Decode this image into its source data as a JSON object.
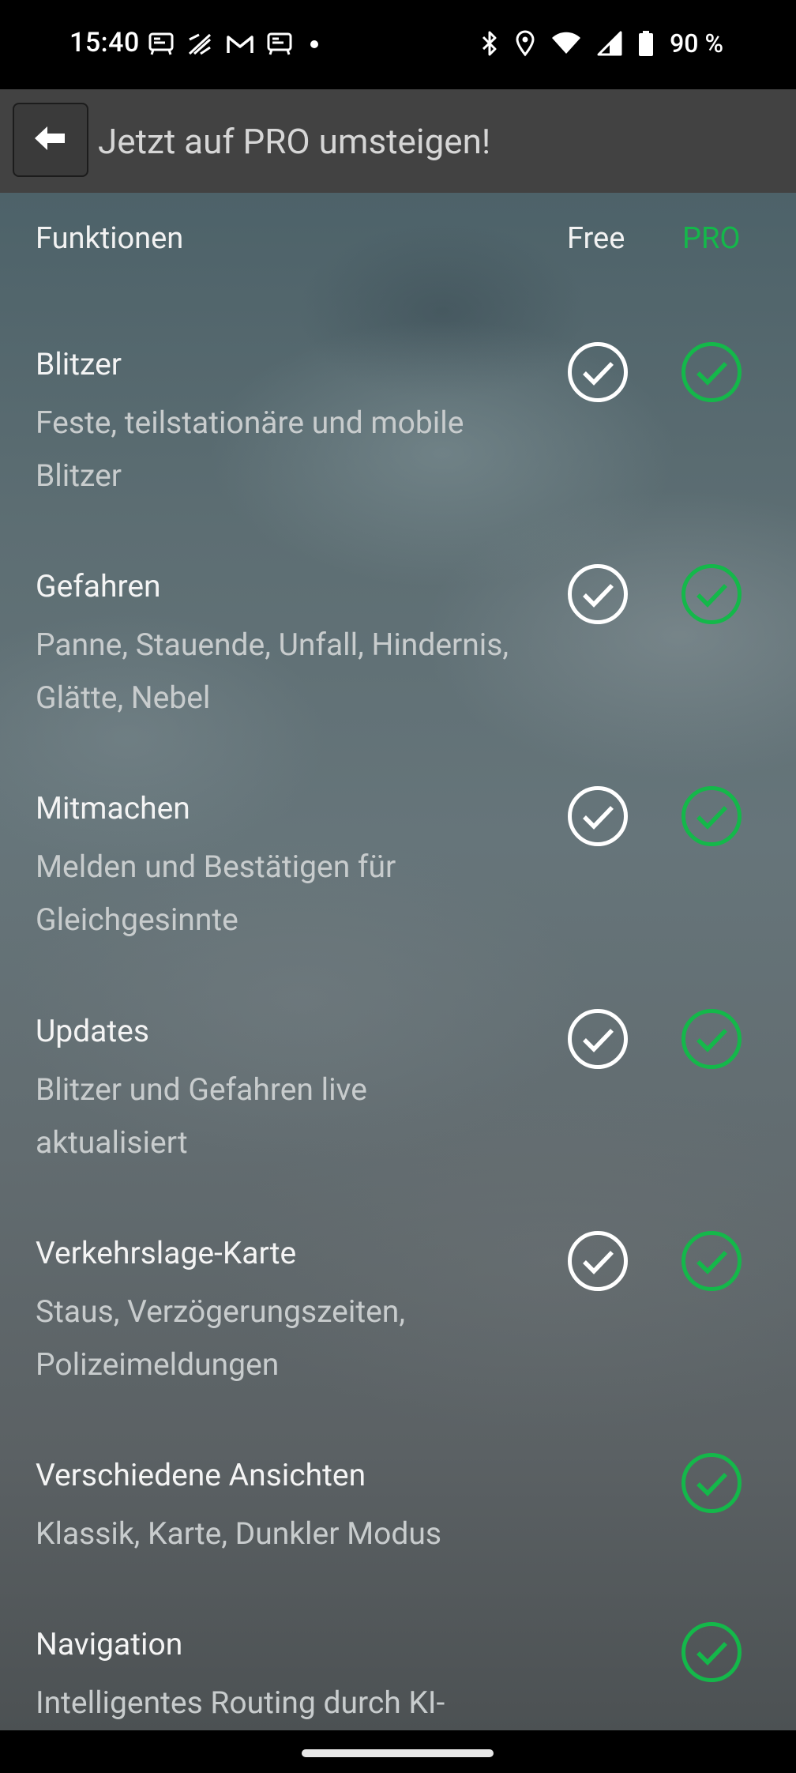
{
  "status_bar": {
    "time": "15:40",
    "battery": "90 %",
    "left_icons": [
      "notification-app-icon",
      "notification-slash-icon",
      "gmail-icon",
      "notification-app-icon",
      "dot-icon"
    ],
    "right_icons": [
      "bluetooth-icon",
      "location-icon",
      "wifi-icon",
      "signal-icon",
      "battery-icon"
    ]
  },
  "app_bar": {
    "back_icon": "arrow-left-icon",
    "title": "Jetzt auf PRO umsteigen!"
  },
  "table": {
    "header": {
      "features": "Funktionen",
      "free": "Free",
      "pro": "PRO"
    },
    "rows": [
      {
        "title": "Blitzer",
        "desc": "Feste, teilstationäre und mobile Blitzer",
        "free": true,
        "pro": true
      },
      {
        "title": "Gefahren",
        "desc": "Panne, Stauende, Unfall, Hindernis, Glätte, Nebel",
        "free": true,
        "pro": true
      },
      {
        "title": "Mitmachen",
        "desc": "Melden und Bestätigen für Gleichgesinnte",
        "free": true,
        "pro": true
      },
      {
        "title": "Updates",
        "desc": "Blitzer und Gefahren live aktualisiert",
        "free": true,
        "pro": true
      },
      {
        "title": "Verkehrslage-Karte",
        "desc": "Staus, Verzögerungszeiten, Polizeimeldungen",
        "free": true,
        "pro": true
      },
      {
        "title": "Verschiedene Ansichten",
        "desc": "Klassik, Karte, Dunkler Modus",
        "free": false,
        "pro": true
      },
      {
        "title": "Navigation",
        "desc": "Intelligentes Routing durch KI-",
        "free": false,
        "pro": true
      }
    ]
  },
  "colors": {
    "pro_green": "#14b84a",
    "free_white": "#ffffff"
  }
}
